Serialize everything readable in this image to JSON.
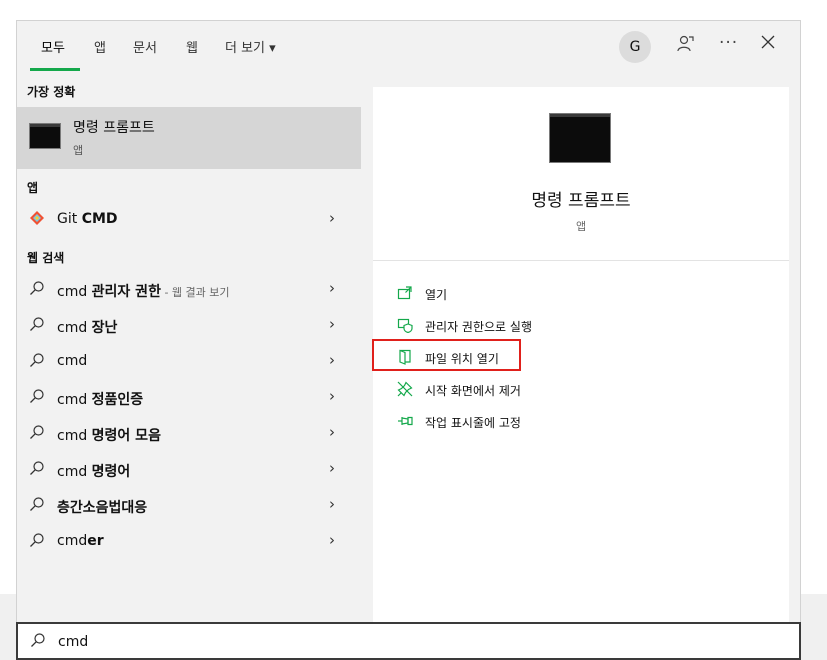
{
  "tabs": [
    {
      "label": "모두"
    },
    {
      "label": "앱"
    },
    {
      "label": "문서"
    },
    {
      "label": "웹"
    },
    {
      "label": "더 보기 ▾"
    }
  ],
  "account": {
    "initial": "G"
  },
  "toolbar": {
    "feedback_icon": "feedback-icon",
    "more_icon": "more-icon",
    "close_icon": "close-icon"
  },
  "left": {
    "best_match_title": "가장 정확",
    "best_match": {
      "title": "명령 프롬프트",
      "subtitle": "앱"
    },
    "apps_title": "앱",
    "apps": [
      {
        "label_plain": "Git ",
        "label_bold": "CMD",
        "icon": "git-icon"
      }
    ],
    "web_title": "웹 검색",
    "web_results": [
      {
        "plain": "cmd ",
        "bold": "관리자 권한",
        "suffix": " - 웹 결과 보기"
      },
      {
        "plain": "cmd ",
        "bold": "장난",
        "suffix": ""
      },
      {
        "plain": "cmd",
        "bold": "",
        "suffix": ""
      },
      {
        "plain": "cmd ",
        "bold": "정품인증",
        "suffix": ""
      },
      {
        "plain": "cmd ",
        "bold": "명령어 모음",
        "suffix": ""
      },
      {
        "plain": "cmd ",
        "bold": "명령어",
        "suffix": ""
      },
      {
        "plain": "",
        "bold": "층간소음법대응",
        "suffix": ""
      },
      {
        "plain": "cmd",
        "bold": "er",
        "suffix": ""
      }
    ]
  },
  "right": {
    "title": "명령 프롬프트",
    "subtitle": "앱",
    "actions": [
      {
        "label": "열기",
        "icon": "open-icon"
      },
      {
        "label": "관리자 권한으로 실행",
        "icon": "shield-icon"
      },
      {
        "label": "파일 위치 열기",
        "icon": "folder-icon"
      },
      {
        "label": "시작 화면에서 제거",
        "icon": "unpin-icon"
      },
      {
        "label": "작업 표시줄에 고정",
        "icon": "pin-icon"
      }
    ]
  },
  "search": {
    "value": "cmd"
  },
  "colors": {
    "accent": "#14a84b",
    "highlight_border": "#e0201b"
  }
}
